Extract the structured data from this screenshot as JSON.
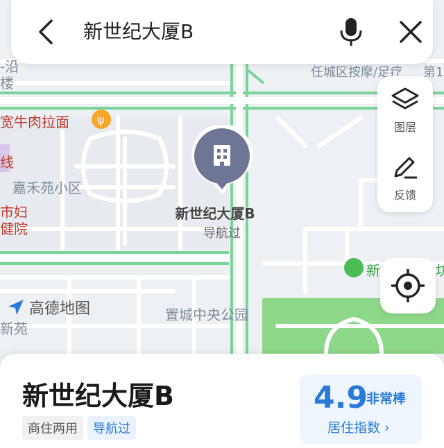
{
  "search": {
    "query": "新世纪大厦B"
  },
  "map_labels": {
    "restaurant": "宽牛肉拉面",
    "residential": "嘉禾苑小区",
    "hospital_line1": "市妇",
    "hospital_line2": "健院",
    "edge_top_left": "-沿",
    "edge_lou": "楼",
    "edge_xian": "线",
    "massage": "任城区按摩/足疗",
    "massage_suffix": "第1",
    "park": "置城中央公园",
    "green_poi": "新",
    "green_poi_suffix": "坊",
    "xinyuan": "新苑"
  },
  "pin": {
    "title": "新世纪大厦B",
    "subtitle": "导航过"
  },
  "tools": {
    "layers": "图层",
    "feedback": "反馈"
  },
  "brand": "高德地图",
  "sheet": {
    "title": "新世纪大厦B",
    "tags": [
      "商住两用",
      "导航过"
    ],
    "score": "4.9",
    "score_rating": "非常棒",
    "score_link": "居住指数 ›"
  },
  "colors": {
    "accent": "#2a7ad8",
    "road_green": "#79d39a",
    "park_green": "#8ed88a",
    "pin": "#6f7594"
  }
}
